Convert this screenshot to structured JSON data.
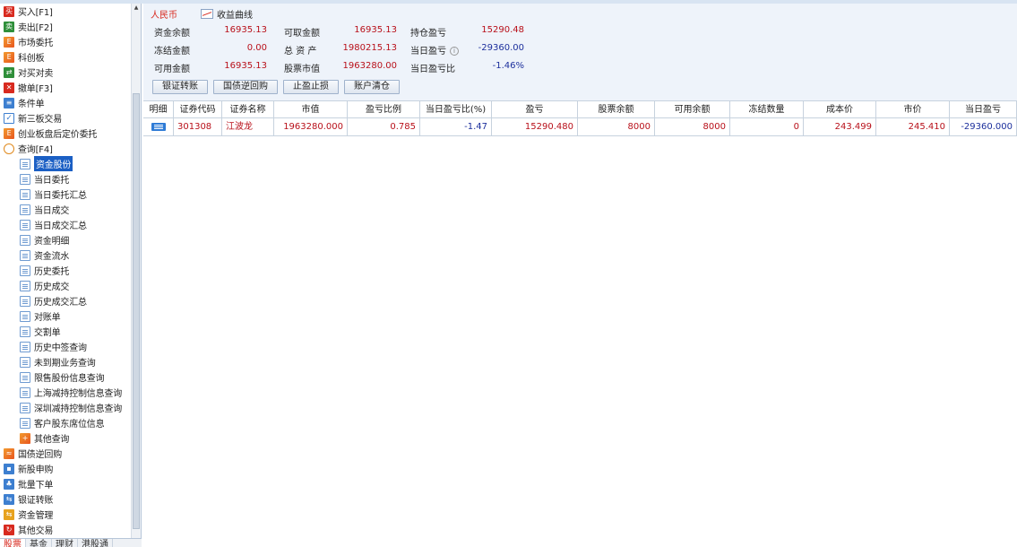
{
  "sidebar": {
    "items": [
      {
        "label": "买入[F1]",
        "icon": "buy-icon",
        "level": 0,
        "interactable": true
      },
      {
        "label": "卖出[F2]",
        "icon": "sell-icon",
        "level": 0,
        "interactable": true
      },
      {
        "label": "市场委托",
        "icon": "market-order-icon",
        "level": 0,
        "interactable": true
      },
      {
        "label": "科创板",
        "icon": "star-market-icon",
        "level": 0,
        "interactable": true
      },
      {
        "label": "对买对卖",
        "icon": "pair-trade-icon",
        "level": 0,
        "interactable": true
      },
      {
        "label": "撤单[F3]",
        "icon": "cancel-order-icon",
        "level": 0,
        "interactable": true
      },
      {
        "label": "条件单",
        "icon": "conditional-order-icon",
        "level": 0,
        "interactable": true
      },
      {
        "label": "新三板交易",
        "icon": "checkbox-icon",
        "level": 0,
        "interactable": true
      },
      {
        "label": "创业板盘后定价委托",
        "icon": "chinext-order-icon",
        "level": 0,
        "interactable": true
      },
      {
        "label": "查询[F4]",
        "icon": "query-icon",
        "level": 0,
        "interactable": true
      },
      {
        "label": "资金股份",
        "icon": "document-icon",
        "level": 1,
        "selected": true,
        "interactable": true
      },
      {
        "label": "当日委托",
        "icon": "document-icon",
        "level": 1,
        "interactable": true
      },
      {
        "label": "当日委托汇总",
        "icon": "document-icon",
        "level": 1,
        "interactable": true
      },
      {
        "label": "当日成交",
        "icon": "document-icon",
        "level": 1,
        "interactable": true
      },
      {
        "label": "当日成交汇总",
        "icon": "document-icon",
        "level": 1,
        "interactable": true
      },
      {
        "label": "资金明细",
        "icon": "document-icon",
        "level": 1,
        "interactable": true
      },
      {
        "label": "资金流水",
        "icon": "document-icon",
        "level": 1,
        "interactable": true
      },
      {
        "label": "历史委托",
        "icon": "document-icon",
        "level": 1,
        "interactable": true
      },
      {
        "label": "历史成交",
        "icon": "document-icon",
        "level": 1,
        "interactable": true
      },
      {
        "label": "历史成交汇总",
        "icon": "document-icon",
        "level": 1,
        "interactable": true
      },
      {
        "label": "对账单",
        "icon": "document-icon",
        "level": 1,
        "interactable": true
      },
      {
        "label": "交割单",
        "icon": "document-icon",
        "level": 1,
        "interactable": true
      },
      {
        "label": "历史中签查询",
        "icon": "document-icon",
        "level": 1,
        "interactable": true
      },
      {
        "label": "未到期业务查询",
        "icon": "document-icon",
        "level": 1,
        "interactable": true
      },
      {
        "label": "限售股份信息查询",
        "icon": "document-icon",
        "level": 1,
        "interactable": true
      },
      {
        "label": "上海减持控制信息查询",
        "icon": "document-icon",
        "level": 1,
        "interactable": true
      },
      {
        "label": "深圳减持控制信息查询",
        "icon": "document-icon",
        "level": 1,
        "interactable": true
      },
      {
        "label": "客户股东席位信息",
        "icon": "document-icon",
        "level": 1,
        "interactable": true
      },
      {
        "label": "其他查询",
        "icon": "other-query-icon",
        "level": 1,
        "interactable": true
      },
      {
        "label": "国债逆回购",
        "icon": "repo-icon",
        "level": 0,
        "interactable": true
      },
      {
        "label": "新股申购",
        "icon": "ipo-icon",
        "level": 0,
        "interactable": true
      },
      {
        "label": "批量下单",
        "icon": "batch-order-icon",
        "level": 0,
        "interactable": true
      },
      {
        "label": "银证转账",
        "icon": "bank-transfer-icon",
        "level": 0,
        "interactable": true
      },
      {
        "label": "资金管理",
        "icon": "fund-management-icon",
        "level": 0,
        "interactable": true
      },
      {
        "label": "其他交易",
        "icon": "other-trade-icon",
        "level": 0,
        "interactable": true
      }
    ]
  },
  "bottom_tabs": [
    "股票",
    "基金",
    "理财",
    "港股通"
  ],
  "account": {
    "currency": "人民币",
    "curve_label": "收益曲线",
    "balance_label": "资金余额",
    "balance": "16935.13",
    "withdrawable_label": "可取金额",
    "withdrawable": "16935.13",
    "holding_pl_label": "持仓盈亏",
    "holding_pl": "15290.48",
    "frozen_label": "冻结金额",
    "frozen": "0.00",
    "total_assets_label": "总 资 产",
    "total_assets": "1980215.13",
    "today_pl_label": "当日盈亏",
    "today_pl": "-29360.00",
    "available_label": "可用金额",
    "available": "16935.13",
    "stock_value_label": "股票市值",
    "stock_value": "1963280.00",
    "today_pl_ratio_label": "当日盈亏比",
    "today_pl_ratio": "-1.46%"
  },
  "buttons": {
    "bank_transfer": "银证转账",
    "repo": "国债逆回购",
    "stop": "止盈止损",
    "clear": "账户清仓"
  },
  "table": {
    "headers": [
      "明细",
      "证券代码",
      "证券名称",
      "市值",
      "盈亏比例",
      "当日盈亏比(%)",
      "盈亏",
      "股票余额",
      "可用余额",
      "冻结数量",
      "成本价",
      "市价",
      "当日盈亏"
    ],
    "rows": [
      {
        "code": "301308",
        "name": "江波龙",
        "market_value": "1963280.000",
        "pl_ratio": "0.785",
        "today_pl_ratio": "-1.47",
        "pl": "15290.480",
        "stock_balance": "8000",
        "available": "8000",
        "frozen": "0",
        "cost": "243.499",
        "price": "245.410",
        "today_pl": "-29360.000"
      }
    ]
  },
  "colors": {
    "positive": "#b8101a",
    "negative": "#1c2f9c",
    "selection": "#1b5fc4"
  }
}
